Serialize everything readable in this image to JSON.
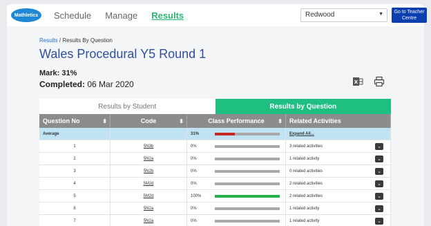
{
  "app": {
    "logo_text": "Mathletics"
  },
  "nav": [
    {
      "label": "Schedule"
    },
    {
      "label": "Manage"
    },
    {
      "label": "Results"
    }
  ],
  "school_select": {
    "value": "Redwood"
  },
  "teacher_centre_button": {
    "line1": "Go to Teacher",
    "line2": "Centre"
  },
  "breadcrumb": {
    "root": "Results",
    "separator": "/",
    "current": "Results By Question"
  },
  "page_title": "Wales Procedural Y5 Round 1",
  "summary": {
    "mark_label": "Mark:",
    "mark_value": "31%",
    "completed_label": "Completed:",
    "completed_value": "06 Mar 2020"
  },
  "tabs": [
    {
      "label": "Results by Student",
      "active": false
    },
    {
      "label": "Results by Question",
      "active": true
    }
  ],
  "table": {
    "headers": [
      "Question No",
      "Code",
      "Class Performance",
      "Related Activities"
    ],
    "average": {
      "label": "Average",
      "pct": "31%",
      "fraction": 0.31,
      "bar_color": "#c62828",
      "activities": "Expand All..."
    },
    "rows": [
      {
        "no": "1",
        "code": "5N3b",
        "pct": "0%",
        "fraction": 0,
        "activities": "3 related activities"
      },
      {
        "no": "2",
        "code": "5N2a",
        "pct": "0%",
        "fraction": 0,
        "activities": "1 related activity"
      },
      {
        "no": "3",
        "code": "5N2b",
        "pct": "0%",
        "fraction": 0,
        "activities": "0 related activities"
      },
      {
        "no": "4",
        "code": "5M2d",
        "pct": "0%",
        "fraction": 0,
        "activities": "2 related activities"
      },
      {
        "no": "5",
        "code": "5M2d",
        "pct": "100%",
        "fraction": 1,
        "activities": "2 related activities"
      },
      {
        "no": "6",
        "code": "5N2a",
        "pct": "0%",
        "fraction": 0,
        "activities": "1 related activity"
      },
      {
        "no": "7",
        "code": "5N2a",
        "pct": "0%",
        "fraction": 0,
        "activities": "1 related activity"
      }
    ],
    "full_bar_color": "#22b14c"
  },
  "colors": {
    "accent": "#1fbf82",
    "title": "#2f4f9e",
    "teacher_button": "#0b3fb0"
  }
}
